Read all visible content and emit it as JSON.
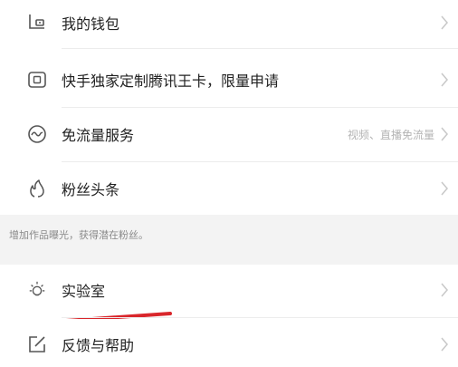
{
  "menu": {
    "wallet": {
      "label": "我的钱包",
      "icon": "wallet-icon"
    },
    "card": {
      "label": "快手独家定制腾讯王卡，限量申请",
      "icon": "sim-card-icon"
    },
    "free_data": {
      "label": "免流量服务",
      "hint": "视频、直播免流量",
      "icon": "wave-circle-icon"
    },
    "fans": {
      "label": "粉丝头条",
      "icon": "flame-icon"
    }
  },
  "section_note": "增加作品曝光，获得潜在粉丝。",
  "menu2": {
    "lab": {
      "label": "实验室",
      "icon": "lightbulb-icon"
    },
    "feedback": {
      "label": "反馈与帮助",
      "icon": "edit-icon"
    }
  },
  "colors": {
    "text": "#222222",
    "hint": "#b4b4b4",
    "icon": "#555555",
    "chevron": "#c8c8c8",
    "divider": "#ececec",
    "section_bg": "#f3f3f3",
    "annotation": "#d9262b"
  }
}
